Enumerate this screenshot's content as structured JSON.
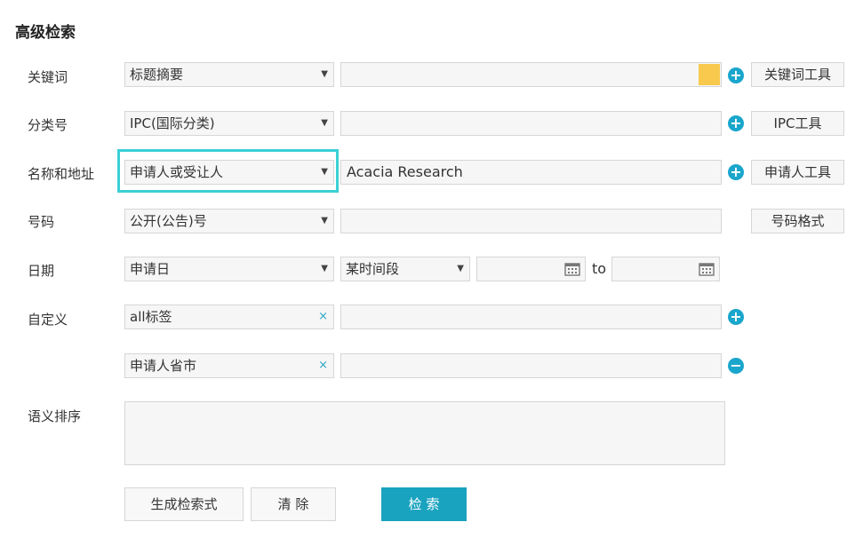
{
  "title": "高级检索",
  "rows": {
    "keyword": {
      "label": "关键词",
      "select": "标题摘要",
      "tool": "关键词工具"
    },
    "classification": {
      "label": "分类号",
      "select": "IPC(国际分类)",
      "tool": "IPC工具"
    },
    "name_address": {
      "label": "名称和地址",
      "select": "申请人或受让人",
      "value": "Acacia Research",
      "tool": "申请人工具"
    },
    "number": {
      "label": "号码",
      "select": "公开(公告)号",
      "tool": "号码格式"
    },
    "date": {
      "label": "日期",
      "select": "申请日",
      "range_select": "某时间段",
      "to": "to"
    },
    "custom": {
      "label": "自定义",
      "tag1": "all标签",
      "tag2": "申请人省市"
    },
    "semantic": {
      "label": "语义排序"
    }
  },
  "buttons": {
    "generate": "生成检索式",
    "clear": "清 除",
    "search": "检 索"
  },
  "icons": {
    "dropdown": "▼",
    "clear": "×",
    "add": "+",
    "remove": "−"
  },
  "colors": {
    "accent": "#1aa3bf",
    "highlight": "#3ad0d6",
    "yellow": "#f9c94d"
  }
}
